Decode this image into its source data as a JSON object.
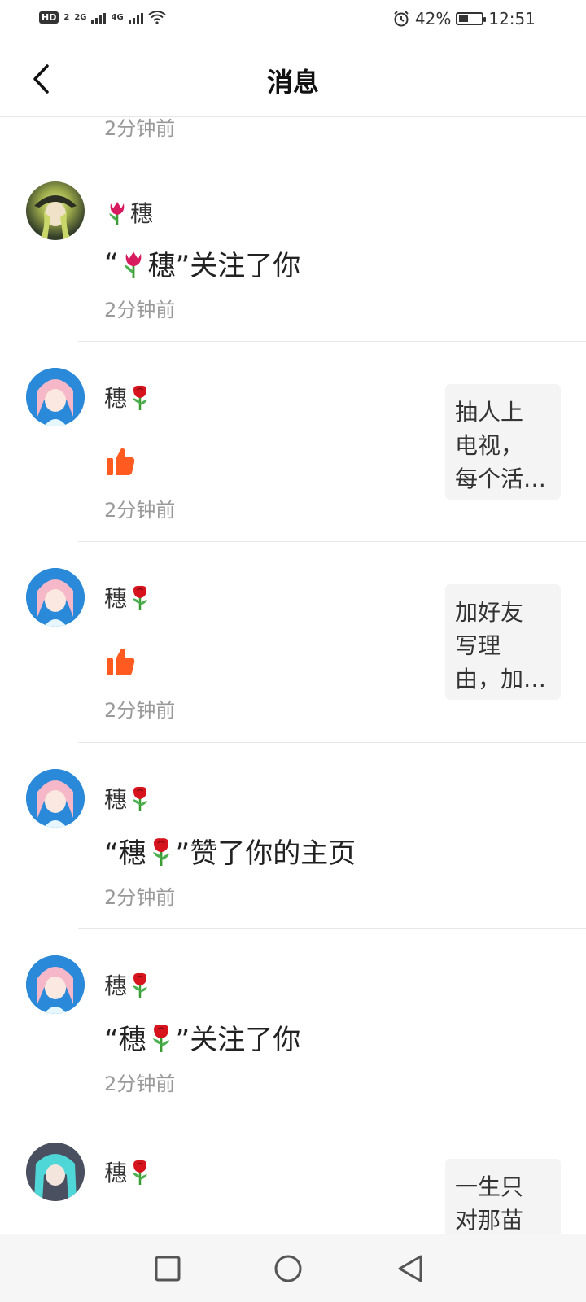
{
  "status_bar": {
    "network_hd": "HD",
    "network_hd_sub": "2",
    "network_2g": "2G",
    "network_4g": "4G",
    "battery_percent": "42%",
    "battery_level": 0.42,
    "time": "12:51"
  },
  "header": {
    "title": "消息"
  },
  "notifications": {
    "partial_top_time": "2分钟前",
    "items": [
      {
        "username": "穗",
        "emoji": "tulip",
        "emoji_position": "before",
        "type": "follow",
        "content_open": "“",
        "content_close": "”关注了你",
        "time": "2分钟前",
        "avatar": "avatar-witch-girl"
      },
      {
        "username": "穗",
        "emoji": "rose",
        "emoji_position": "after",
        "type": "like",
        "time": "2分钟前",
        "avatar": "avatar-pink-hair-girl",
        "preview": [
          "抽人上",
          "电视，",
          "每个活…"
        ]
      },
      {
        "username": "穗",
        "emoji": "rose",
        "emoji_position": "after",
        "type": "like",
        "time": "2分钟前",
        "avatar": "avatar-pink-hair-girl",
        "preview": [
          "加好友",
          "写理",
          "由，加…"
        ]
      },
      {
        "username": "穗",
        "emoji": "rose",
        "emoji_position": "after",
        "type": "like-profile",
        "content_open": "“穗",
        "content_close": "”赞了你的主页",
        "time": "2分钟前",
        "avatar": "avatar-pink-hair-girl"
      },
      {
        "username": "穗",
        "emoji": "rose",
        "emoji_position": "after",
        "type": "follow",
        "content_open": "“穗",
        "content_close": "”关注了你",
        "time": "2分钟前",
        "avatar": "avatar-pink-hair-girl"
      },
      {
        "username": "穗",
        "emoji": "rose",
        "emoji_position": "after",
        "type": "partial",
        "avatar": "avatar-teal-hair-girl",
        "preview": [
          "一生只",
          "对那苗"
        ]
      }
    ]
  },
  "bottom_nav": {
    "recent_icon": "square-icon",
    "home_icon": "circle-icon",
    "back_icon": "triangle-back-icon"
  },
  "colors": {
    "thumb": "#ff5a1f",
    "rose": "#d7141e",
    "tulip": "#d81b60",
    "stem": "#3a9b32",
    "muted_text": "#999999"
  }
}
